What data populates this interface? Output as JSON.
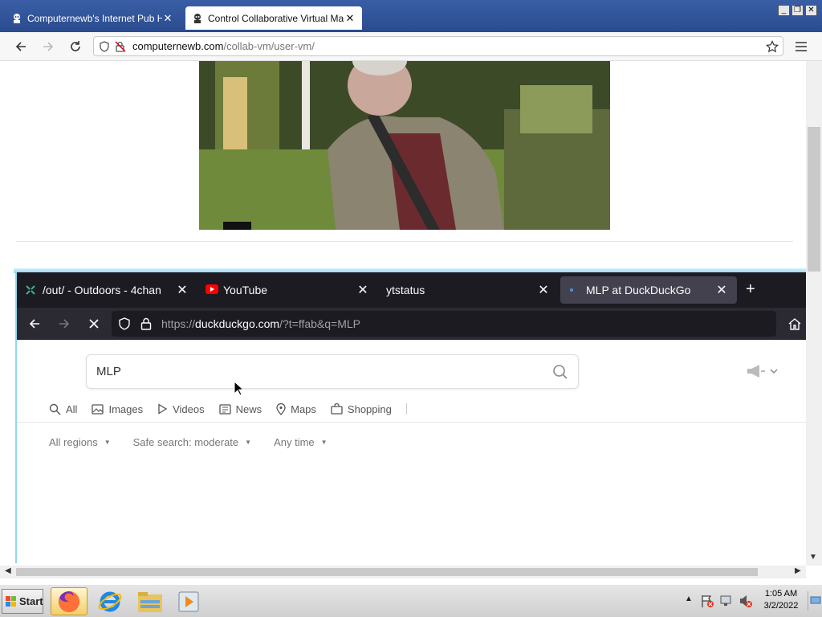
{
  "outer_browser": {
    "tabs": [
      {
        "title": "Computernewb's Internet Pub Hub",
        "active": false
      },
      {
        "title": "Control Collaborative Virtual Machine",
        "active": true
      }
    ],
    "url_host": "computernewb.com",
    "url_path": "/collab-vm/user-vm/"
  },
  "inner_browser": {
    "tabs": [
      {
        "title": "/out/ - Outdoors - 4chan",
        "icon": "4chan-icon"
      },
      {
        "title": "YouTube",
        "icon": "youtube-icon"
      },
      {
        "title": "ytstatus",
        "icon": "none"
      },
      {
        "title": "MLP at DuckDuckGo",
        "icon": "loading-dot-icon",
        "active": true
      }
    ],
    "url_prefix": "https://",
    "url_host": "duckduckgo.com",
    "url_query": "/?t=ffab&q=MLP"
  },
  "ddg": {
    "query": "MLP",
    "filters": [
      "All",
      "Images",
      "Videos",
      "News",
      "Maps",
      "Shopping"
    ],
    "options": [
      "All regions",
      "Safe search: moderate",
      "Any time"
    ]
  },
  "taskbar": {
    "start_label": "Start",
    "time": "1:05 AM",
    "date": "3/2/2022"
  },
  "colors": {
    "outer_tabbar": "#2d4f94",
    "inner_tabbar": "#1c1b22",
    "vm_border": "#8fd7f0"
  }
}
